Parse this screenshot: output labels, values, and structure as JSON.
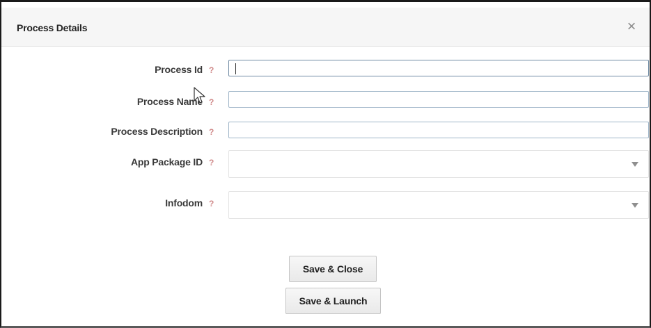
{
  "dialog": {
    "title": "Process Details",
    "close_symbol": "×",
    "close_icon": "close-icon"
  },
  "form": {
    "help_symbol": "?",
    "fields": [
      {
        "label": "Process Id",
        "value": "",
        "type": "text"
      },
      {
        "label": "Process Name",
        "value": "",
        "type": "text"
      },
      {
        "label": "Process Description",
        "value": "",
        "type": "text"
      },
      {
        "label": "App Package ID",
        "value": "",
        "type": "select"
      },
      {
        "label": "Infodom",
        "value": "",
        "type": "select"
      }
    ]
  },
  "buttons": {
    "save_close": "Save & Close",
    "save_launch": "Save & Launch"
  },
  "colors": {
    "help_icon": "#d08a8a",
    "input_border": "#9fb5c8",
    "header_bg": "#f6f6f6"
  }
}
